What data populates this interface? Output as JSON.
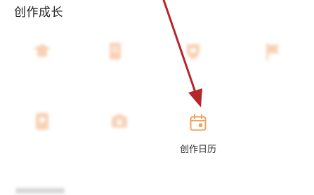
{
  "section": {
    "title": "创作成长"
  },
  "items": [
    {
      "label": "",
      "icon": "graduation-cap-icon",
      "blurred": true
    },
    {
      "label": "",
      "icon": "document-icon",
      "blurred": true
    },
    {
      "label": "",
      "icon": "shield-icon",
      "blurred": true
    },
    {
      "label": "",
      "icon": "flag-icon",
      "blurred": true
    },
    {
      "label": "",
      "icon": "certificate-icon",
      "blurred": true
    },
    {
      "label": "",
      "icon": "camera-icon",
      "blurred": true
    },
    {
      "label": "创作日历",
      "icon": "calendar-icon",
      "blurred": false
    }
  ],
  "colors": {
    "accent": "#f3a15c",
    "arrow": "#b5262b",
    "blurred_icon": "#f7c9a6"
  }
}
